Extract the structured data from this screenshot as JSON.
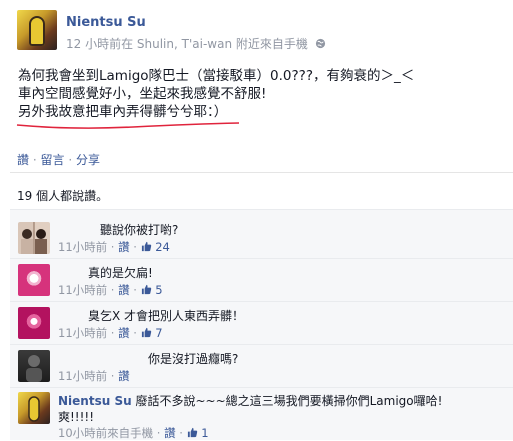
{
  "post": {
    "author": "Nientsu Su",
    "time": "12 小時前在 Shulin, T'ai-wan 附近來自手機",
    "lines": [
      "為何我會坐到Lamigo隊巴士（當接駁車）0.0???，有夠衰的＞_＜",
      "車內空間感覺好小，坐起來我感覺不舒服!",
      "另外我故意把車內弄得髒兮兮耶：）"
    ],
    "actions": {
      "like": "讚",
      "comment": "留言",
      "share": "分享",
      "sep": "·"
    },
    "likes_summary": "19 個人都說讚。"
  },
  "comments": [
    {
      "text": "聽說你被打喲?",
      "time": "11小時前",
      "like": "讚",
      "likes": "24",
      "avatar": "photo-icon"
    },
    {
      "text": "真的是欠扁!",
      "time": "11小時前",
      "like": "讚",
      "likes": "5",
      "avatar": "pink-flower-icon"
    },
    {
      "text": "臭乞X 才會把別人東西弄髒！",
      "time": "11小時前",
      "like": "讚",
      "likes": "7",
      "avatar": "pink-flower-icon"
    },
    {
      "text": "你是沒打過癮嗎?",
      "time": "11小時前",
      "like": "讚",
      "likes": "",
      "avatar": "dark-figure-icon"
    },
    {
      "author": "Nientsu Su",
      "text": "廢話不多說~~~總之這三場我們要橫掃你們Lamigo囉哈!",
      "text2": "爽!!!!!",
      "time": "10小時前來自手機",
      "like": "讚",
      "likes": "1",
      "avatar": "profile-icon"
    }
  ],
  "colors": {
    "link": "#3b5998",
    "underline": "#e0243c",
    "meta": "#9197a3"
  }
}
